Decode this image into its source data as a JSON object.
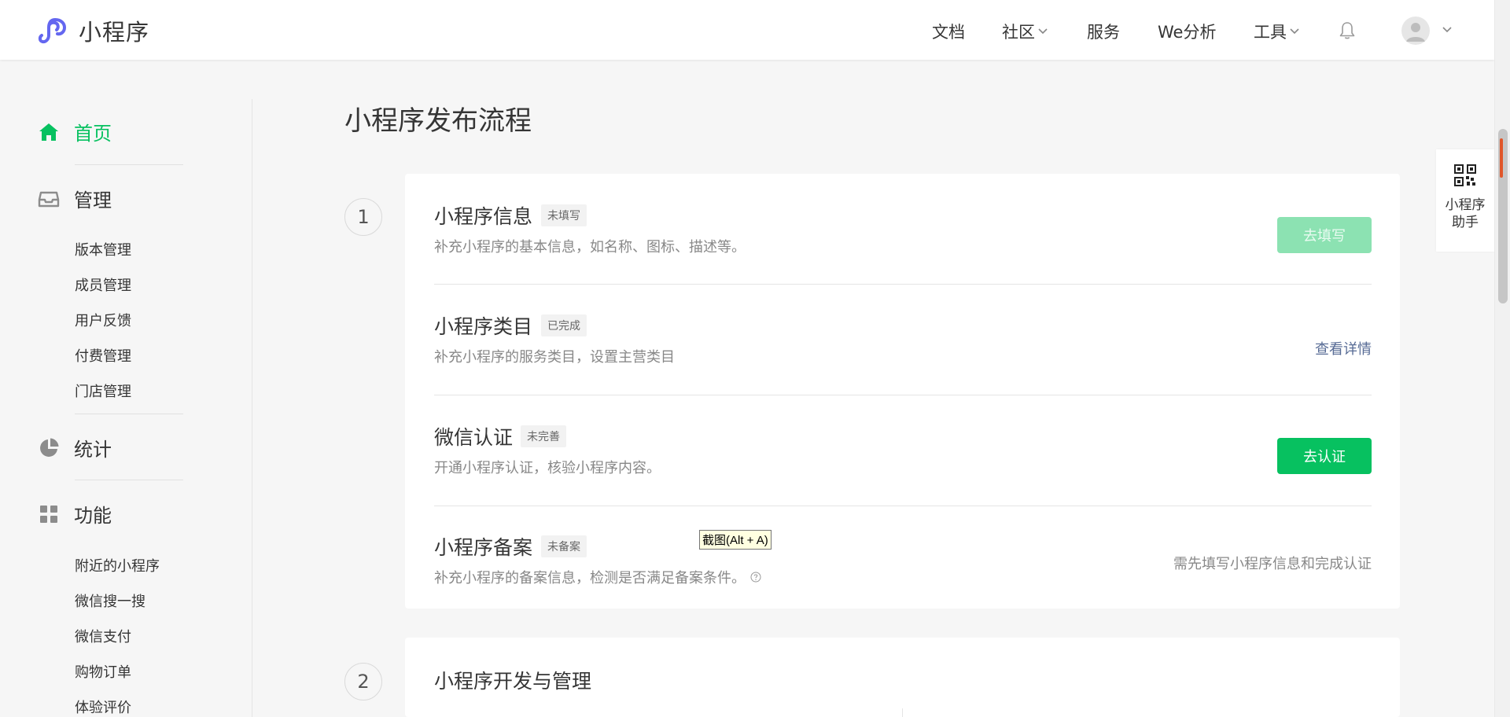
{
  "brand": {
    "name": "小程序"
  },
  "nav": {
    "docs": "文档",
    "community": "社区",
    "service": "服务",
    "analytics": "We分析",
    "tools": "工具"
  },
  "sidebar": {
    "home": "首页",
    "manage": "管理",
    "manage_items": [
      "版本管理",
      "成员管理",
      "用户反馈",
      "付费管理",
      "门店管理"
    ],
    "stats": "统计",
    "features": "功能",
    "feature_items": [
      "附近的小程序",
      "微信搜一搜",
      "微信支付",
      "购物订单",
      "体验评价"
    ]
  },
  "main": {
    "title": "小程序发布流程",
    "step1": {
      "number": "1",
      "rows": [
        {
          "title": "小程序信息",
          "badge": "未填写",
          "desc": "补充小程序的基本信息，如名称、图标、描述等。",
          "action": "去填写"
        },
        {
          "title": "小程序类目",
          "badge": "已完成",
          "desc": "补充小程序的服务类目，设置主营类目",
          "action": "查看详情"
        },
        {
          "title": "微信认证",
          "badge": "未完善",
          "desc": "开通小程序认证，核验小程序内容。",
          "action": "去认证"
        },
        {
          "title": "小程序备案",
          "badge": "未备案",
          "desc": "补充小程序的备案信息，检测是否满足备案条件。",
          "action": "需先填写小程序信息和完成认证"
        }
      ]
    },
    "step2": {
      "number": "2",
      "title": "小程序开发与管理"
    }
  },
  "tooltip": "截图(Alt + A)",
  "assistant": {
    "label": "小程序助手"
  },
  "colors": {
    "accent": "#07c160",
    "link": "#576b95",
    "disabled_button": "#8ce2b2"
  }
}
